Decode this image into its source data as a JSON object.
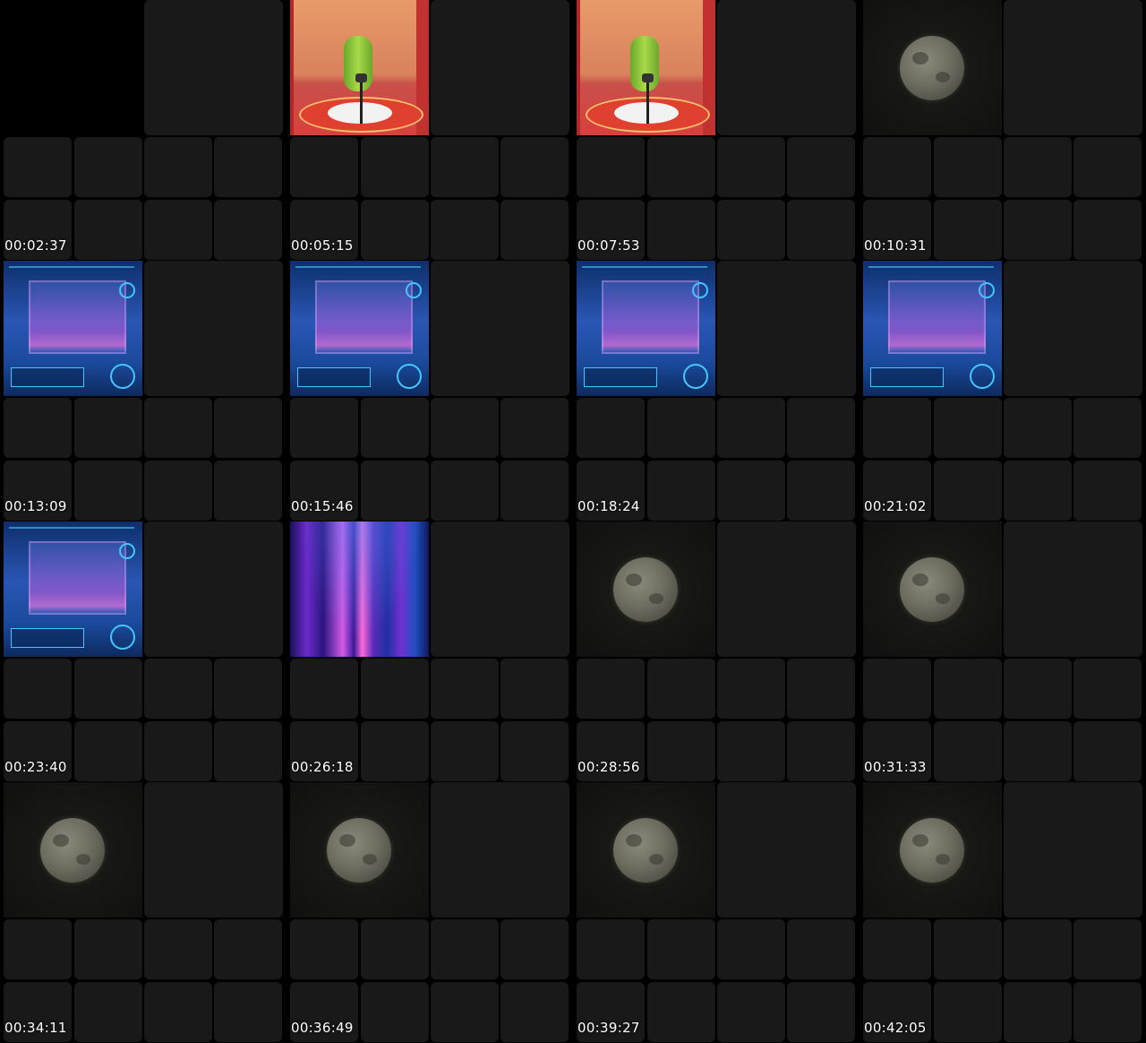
{
  "cells": [
    {
      "timestamp": "",
      "thumb": "none"
    },
    {
      "timestamp": "00:02:37",
      "thumb": "stage"
    },
    {
      "timestamp": "00:05:15",
      "thumb": "stage"
    },
    {
      "timestamp": "00:07:53",
      "thumb": "moon"
    },
    {
      "timestamp": "00:10:31",
      "thumb": "hud"
    },
    {
      "timestamp": "00:13:09",
      "thumb": "hud"
    },
    {
      "timestamp": "00:15:46",
      "thumb": "hud"
    },
    {
      "timestamp": "00:18:24",
      "thumb": "hud"
    },
    {
      "timestamp": "00:21:02",
      "thumb": "hud"
    },
    {
      "timestamp": "00:23:40",
      "thumb": "aurora"
    },
    {
      "timestamp": "00:26:18",
      "thumb": "moon"
    },
    {
      "timestamp": "00:28:56",
      "thumb": "moon"
    },
    {
      "timestamp": "00:31:33",
      "thumb": "moon"
    },
    {
      "timestamp": "00:34:11",
      "thumb": "moon"
    },
    {
      "timestamp": "00:36:49",
      "thumb": "moon"
    },
    {
      "timestamp": "00:39:27",
      "thumb": "moon"
    }
  ],
  "last_label": "00:42:05",
  "colors": {
    "background": "#000000",
    "tile": "#191919",
    "timestamp": "#ffffff"
  }
}
